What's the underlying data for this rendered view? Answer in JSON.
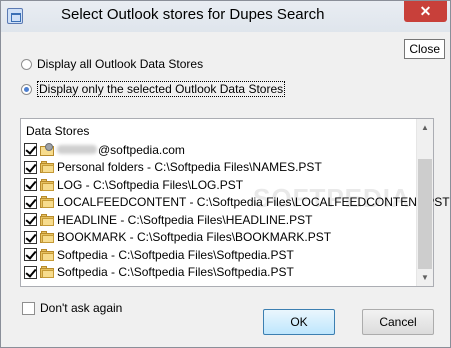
{
  "window": {
    "title": "Select Outlook stores for Dupes Search",
    "close_label": "✕",
    "close_tooltip": "Close"
  },
  "options": {
    "all_label": "Display all Outlook Data Stores",
    "selected_label": "Display only the selected Outlook Data Stores",
    "selected_option": "selected"
  },
  "stores": {
    "header": "Data Stores",
    "items": [
      {
        "label": "@softpedia.com",
        "checked": true,
        "icon": "mailbox-icon"
      },
      {
        "label": "Personal folders - C:\\Softpedia Files\\NAMES.PST",
        "checked": true,
        "icon": "folder-icon"
      },
      {
        "label": "LOG - C:\\Softpedia Files\\LOG.PST",
        "checked": true,
        "icon": "folder-icon"
      },
      {
        "label": "LOCALFEEDCONTENT - C:\\Softpedia Files\\LOCALFEEDCONTENT.PST",
        "checked": true,
        "icon": "folder-icon"
      },
      {
        "label": "HEADLINE - C:\\Softpedia Files\\HEADLINE.PST",
        "checked": true,
        "icon": "folder-icon"
      },
      {
        "label": "BOOKMARK - C:\\Softpedia Files\\BOOKMARK.PST",
        "checked": true,
        "icon": "folder-icon"
      },
      {
        "label": "Softpedia - C:\\Softpedia Files\\Softpedia.PST",
        "checked": true,
        "icon": "folder-icon"
      },
      {
        "label": "Softpedia - C:\\Softpedia Files\\Softpedia.PST",
        "checked": true,
        "icon": "folder-icon"
      }
    ]
  },
  "footer": {
    "dont_ask_label": "Don't ask again",
    "dont_ask_checked": false,
    "ok_label": "OK",
    "cancel_label": "Cancel"
  },
  "watermark": "SOFTPEDIA"
}
